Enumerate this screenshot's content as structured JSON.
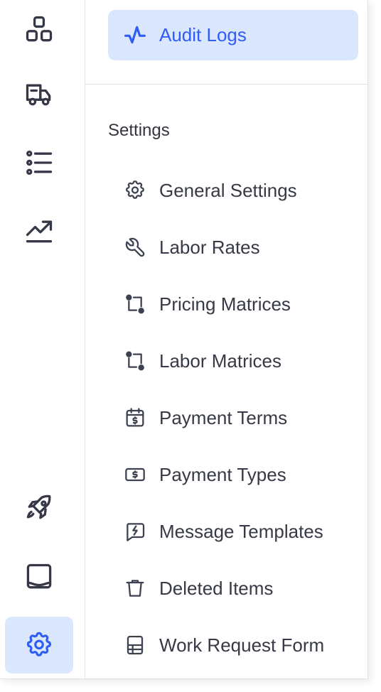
{
  "rail": {
    "items": [
      {
        "icon": "apps-icon"
      },
      {
        "icon": "truck-icon"
      },
      {
        "icon": "list-icon"
      },
      {
        "icon": "trending-up-icon"
      },
      {
        "icon": "rocket-icon"
      },
      {
        "icon": "inbox-icon"
      },
      {
        "icon": "gear-icon",
        "active": true
      }
    ]
  },
  "panel": {
    "audit": {
      "label": "Audit Logs",
      "icon": "activity-icon",
      "active": true
    },
    "section_title": "Settings",
    "items": [
      {
        "label": "General Settings",
        "icon": "gear-icon"
      },
      {
        "label": "Labor Rates",
        "icon": "wrench-icon"
      },
      {
        "label": "Pricing Matrices",
        "icon": "route-icon"
      },
      {
        "label": "Labor Matrices",
        "icon": "route-icon"
      },
      {
        "label": "Payment Terms",
        "icon": "calendar-dollar-icon"
      },
      {
        "label": "Payment Types",
        "icon": "cash-icon"
      },
      {
        "label": "Message Templates",
        "icon": "message-bolt-icon"
      },
      {
        "label": "Deleted Items",
        "icon": "trash-icon"
      },
      {
        "label": "Work Request Form",
        "icon": "form-icon"
      }
    ]
  },
  "colors": {
    "accent": "#2f5df5",
    "active_bg": "#dbe7fd",
    "text": "#373a46"
  }
}
